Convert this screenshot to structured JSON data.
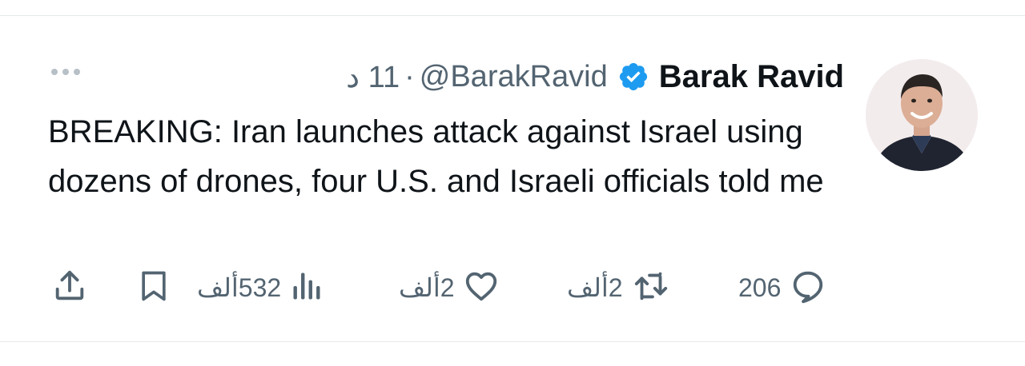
{
  "tweet": {
    "author_name": "Barak Ravid",
    "handle": "@BarakRavid",
    "separator": "·",
    "time": "11 د",
    "text": "BREAKING: Iran launches attack against Israel using dozens of drones, four U.S. and Israeli officials told me"
  },
  "actions": {
    "replies": "206",
    "reposts": "2ألف",
    "likes": "2ألف",
    "views": "532ألف"
  },
  "icons": {
    "verified": "verified-badge-icon",
    "more": "more-options-icon",
    "reply": "reply-icon",
    "repost": "repost-icon",
    "like": "like-icon",
    "views": "views-icon",
    "bookmark": "bookmark-icon",
    "share": "share-icon"
  },
  "colors": {
    "verified_blue": "#1d9bf0",
    "text_primary": "#0f1419",
    "text_secondary": "#536471"
  }
}
